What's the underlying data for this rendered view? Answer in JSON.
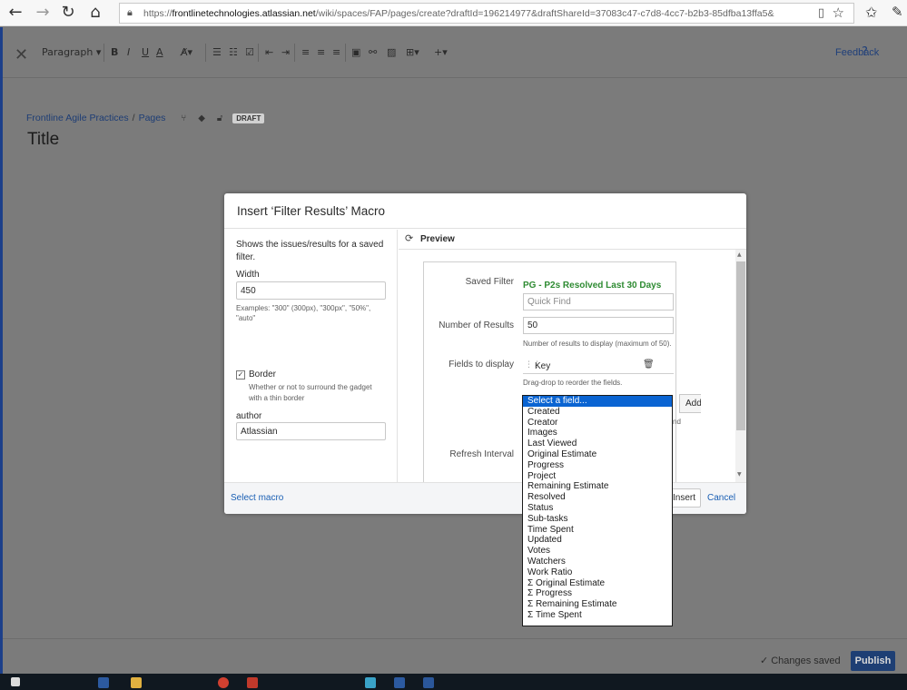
{
  "browser": {
    "url_prefix": "https://",
    "url_host": "frontlinetechnologies.atlassian.net",
    "url_path": "/wiki/spaces/FAP/pages/create?draftId=196214977&draftShareId=37083c47-c7d8-4cc7-b2b3-85dfba13ffa5&",
    "back_icon": "←",
    "forward_icon": "→",
    "refresh_icon": "↻",
    "home_icon": "⌂"
  },
  "editor_toolbar": {
    "style_dropdown": "Paragraph",
    "bold": "B",
    "italic": "I",
    "underline": "U",
    "text_color": "A",
    "feedback": "Feedback",
    "help": "?"
  },
  "breadcrumbs": {
    "space": "Frontline Agile Practices",
    "pages": "Pages",
    "status": "DRAFT"
  },
  "page_title": "Title",
  "footer": {
    "changes_saved": "Changes saved",
    "publish": "Publish"
  },
  "modal": {
    "title": "Insert ‘Filter Results’ Macro",
    "description": "Shows the issues/results for a saved filter.",
    "width_label": "Width",
    "width_value": "450",
    "width_hint": "Examples: \"300\" (300px), \"300px\", \"50%\", \"auto\"",
    "border_label": "Border",
    "border_checked": true,
    "border_hint": "Whether or not to surround the gadget with a thin border",
    "author_label": "author",
    "author_value": "Atlassian",
    "preview_label": "Preview",
    "select_macro": "Select macro",
    "insert": "Insert",
    "cancel": "Cancel"
  },
  "gadget": {
    "saved_filter_label": "Saved Filter",
    "saved_filter_value": "PG - P2s Resolved Last 30 Days",
    "quick_find_placeholder": "Quick Find",
    "num_results_label": "Number of Results",
    "num_results_value": "50",
    "num_results_hint": "Number of results to display (maximum of 50).",
    "fields_label": "Fields to display",
    "field_key": "Key",
    "fields_hint": "Drag-drop to reorder the fields.",
    "add_button": "Add",
    "partial_text": "nd",
    "refresh_label": "Refresh Interval"
  },
  "dropdown_options": [
    "Select a field...",
    "Created",
    "Creator",
    "Images",
    "Last Viewed",
    "Original Estimate",
    "Progress",
    "Project",
    "Remaining Estimate",
    "Resolved",
    "Status",
    "Sub-tasks",
    "Time Spent",
    "Updated",
    "Votes",
    "Watchers",
    "Work Ratio",
    "Σ Original Estimate",
    "Σ Progress",
    "Σ Remaining Estimate",
    "Σ Time Spent"
  ],
  "dropdown_selected_index": 0,
  "colors": {
    "accent": "#0a64d2",
    "saved_filter_green": "#2e8b32",
    "link_blue": "#1a5fb4",
    "publish_button": "#1e3f74"
  }
}
